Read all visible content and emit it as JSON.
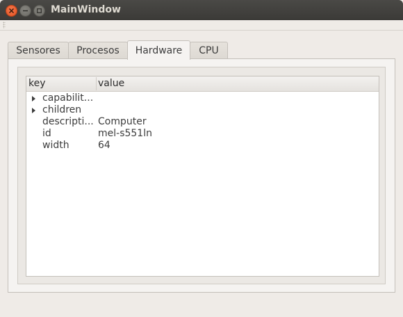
{
  "window": {
    "title": "MainWindow"
  },
  "tabs": [
    {
      "label": "Sensores"
    },
    {
      "label": "Procesos"
    },
    {
      "label": "Hardware",
      "active": true
    },
    {
      "label": "CPU"
    }
  ],
  "tree": {
    "columns": [
      "key",
      "value"
    ],
    "rows": [
      {
        "key": "capabilit...",
        "value": "",
        "expandable": true
      },
      {
        "key": "children",
        "value": "",
        "expandable": true
      },
      {
        "key": "descripti...",
        "value": "Computer",
        "expandable": false
      },
      {
        "key": "id",
        "value": "mel-s551ln",
        "expandable": false
      },
      {
        "key": "width",
        "value": "64",
        "expandable": false
      }
    ]
  },
  "colors": {
    "titlebar": "#3b3a37",
    "close": "#e5501f",
    "background": "#efebe7"
  },
  "icons": [
    "close-icon",
    "minimize-icon",
    "maximize-icon",
    "expand-arrow-icon"
  ]
}
